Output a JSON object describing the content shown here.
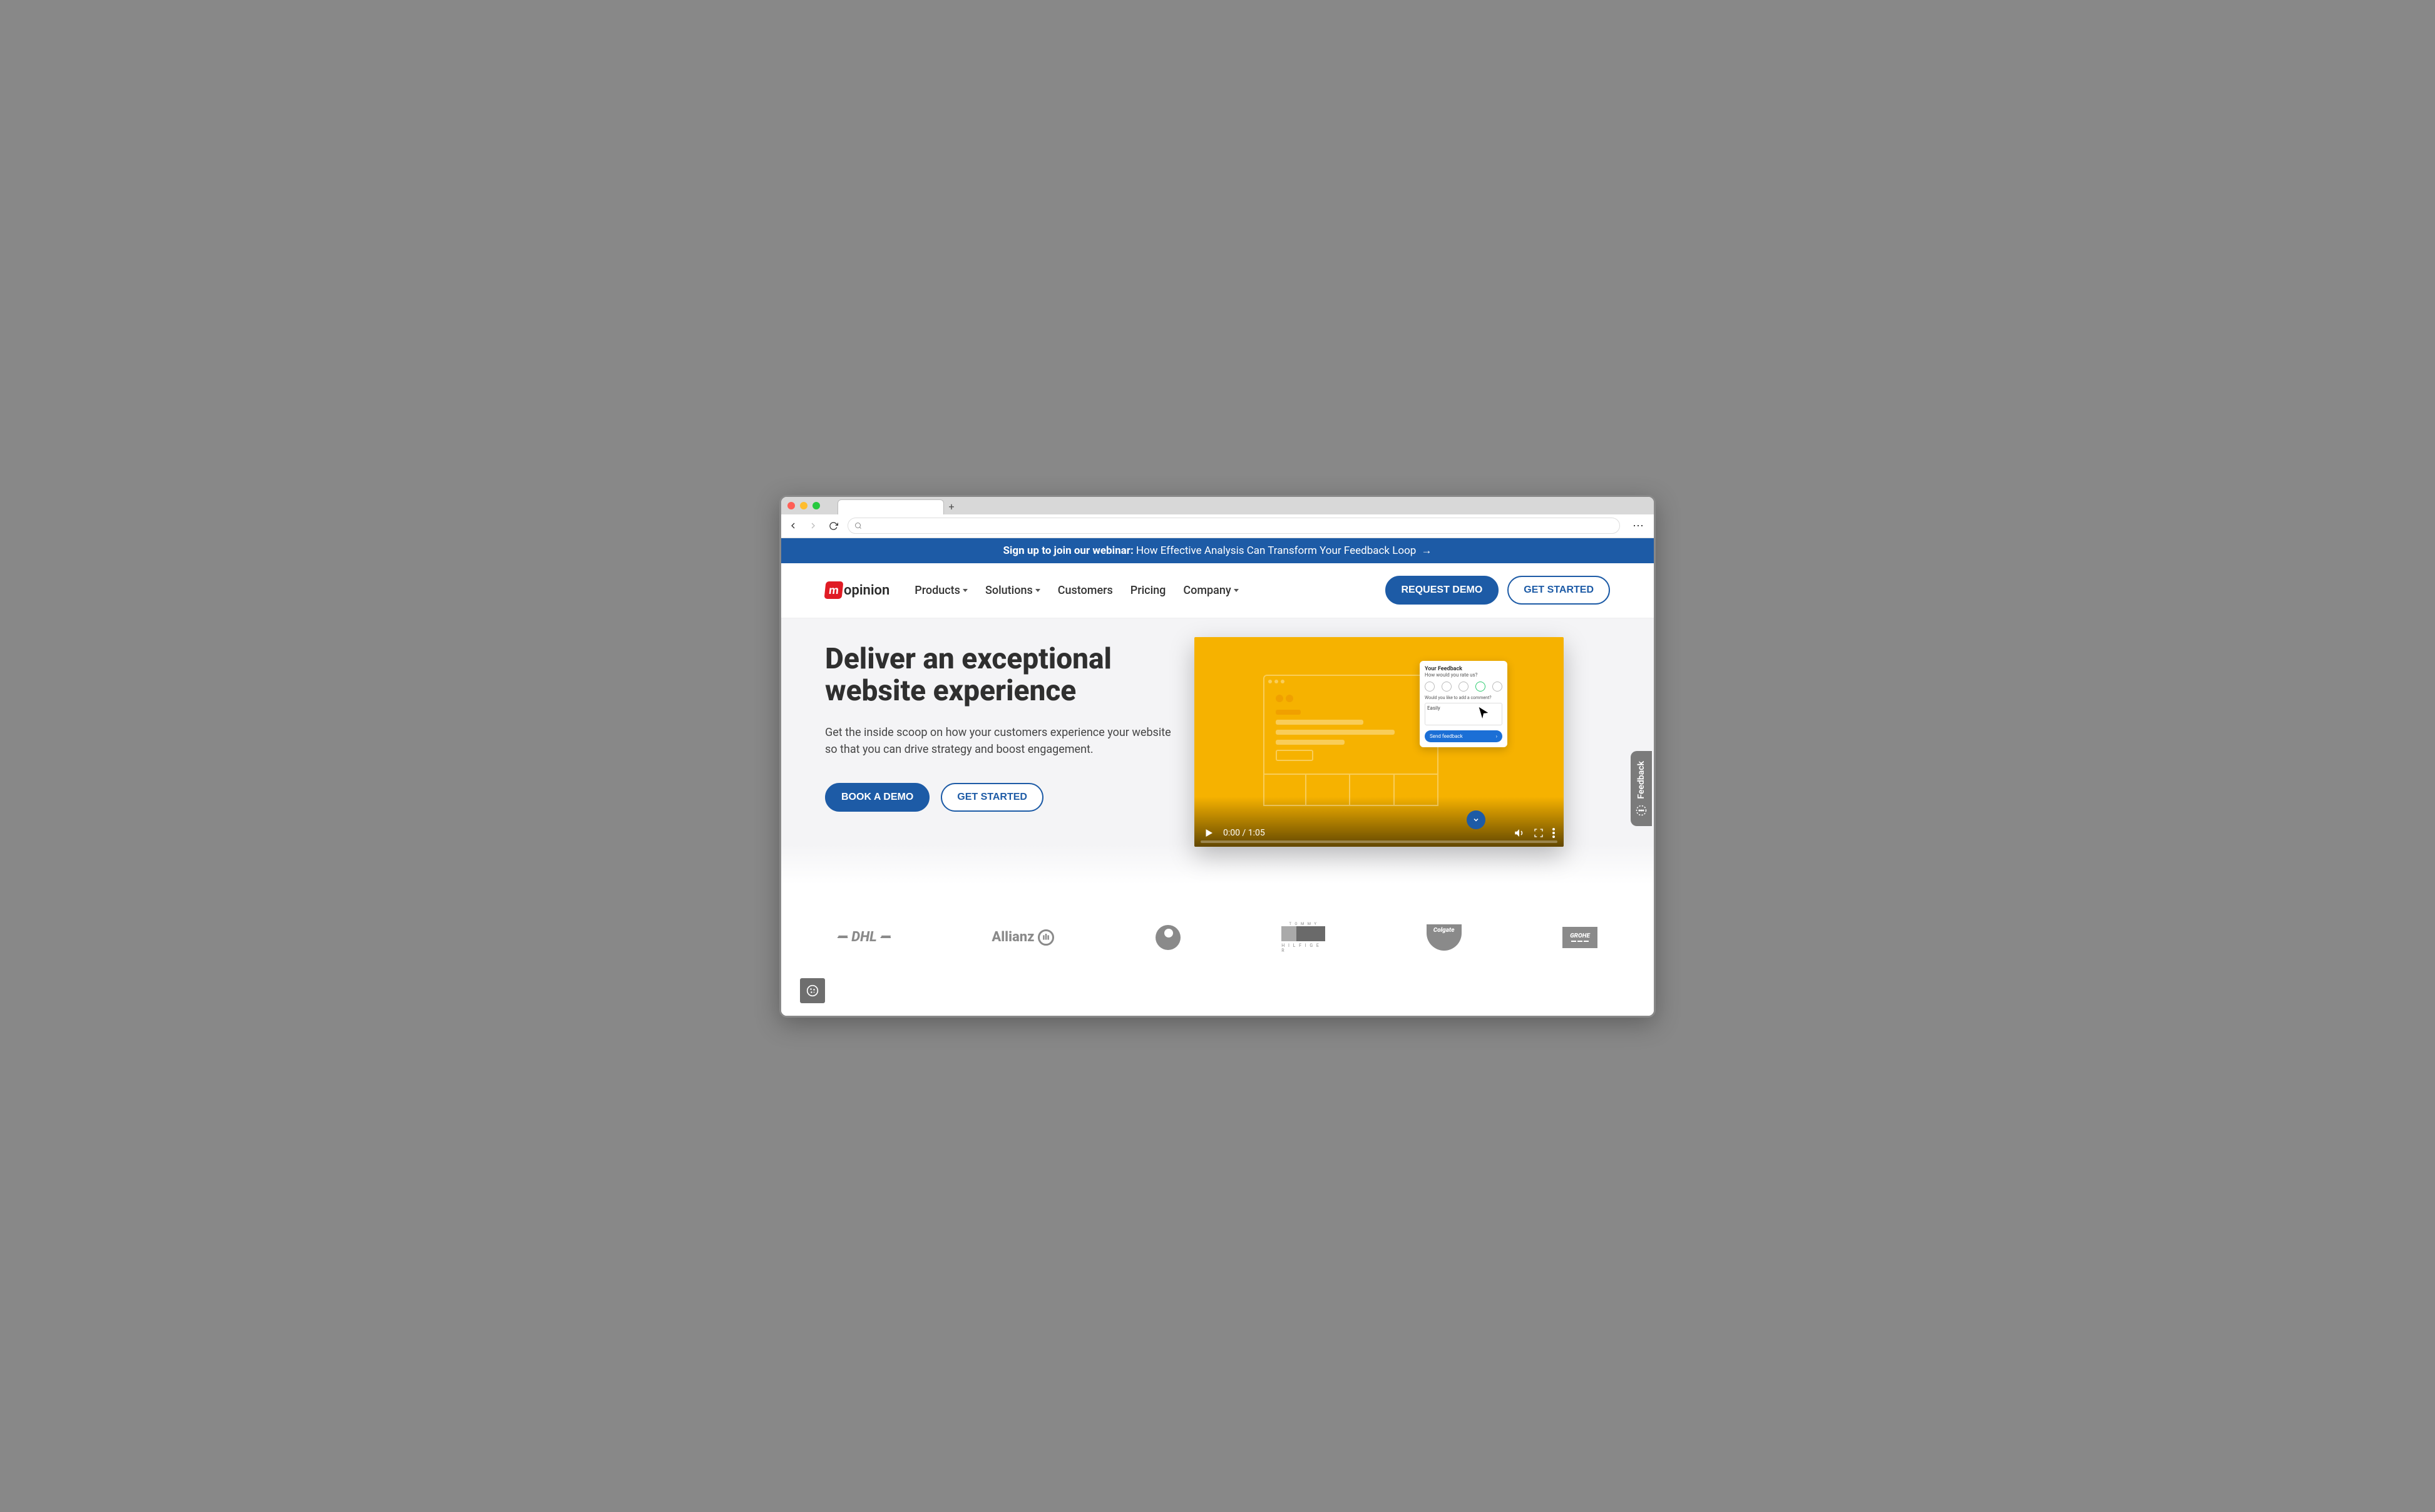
{
  "banner": {
    "lead": "Sign up to join our webinar:",
    "rest": "How Effective Analysis Can Transform Your Feedback Loop",
    "arrow": "→"
  },
  "logo": {
    "mark": "m",
    "text": "opinion"
  },
  "nav": {
    "products": "Products",
    "solutions": "Solutions",
    "customers": "Customers",
    "pricing": "Pricing",
    "company": "Company"
  },
  "cta": {
    "request_demo": "REQUEST DEMO",
    "get_started_nav": "GET STARTED"
  },
  "hero": {
    "title": "Deliver an exceptional website experience",
    "sub": "Get the inside scoop on how your customers experience your website so that you can drive strategy and boost engagement.",
    "book_demo": "BOOK A DEMO",
    "get_started": "GET STARTED"
  },
  "video": {
    "time": "0:00 / 1:05"
  },
  "feedback_card": {
    "title": "Your Feedback",
    "sub": "How would you rate us?",
    "comment_q": "Would you like to add a comment?",
    "comment_text": "Easily",
    "send": "Send feedback"
  },
  "side_feedback": "Feedback",
  "logos": {
    "dhl": "DHL",
    "allianz": "Allianz",
    "tommy": "TOMMY HILFIGER",
    "colgate": "Colgate",
    "grohe": "GROHE"
  }
}
